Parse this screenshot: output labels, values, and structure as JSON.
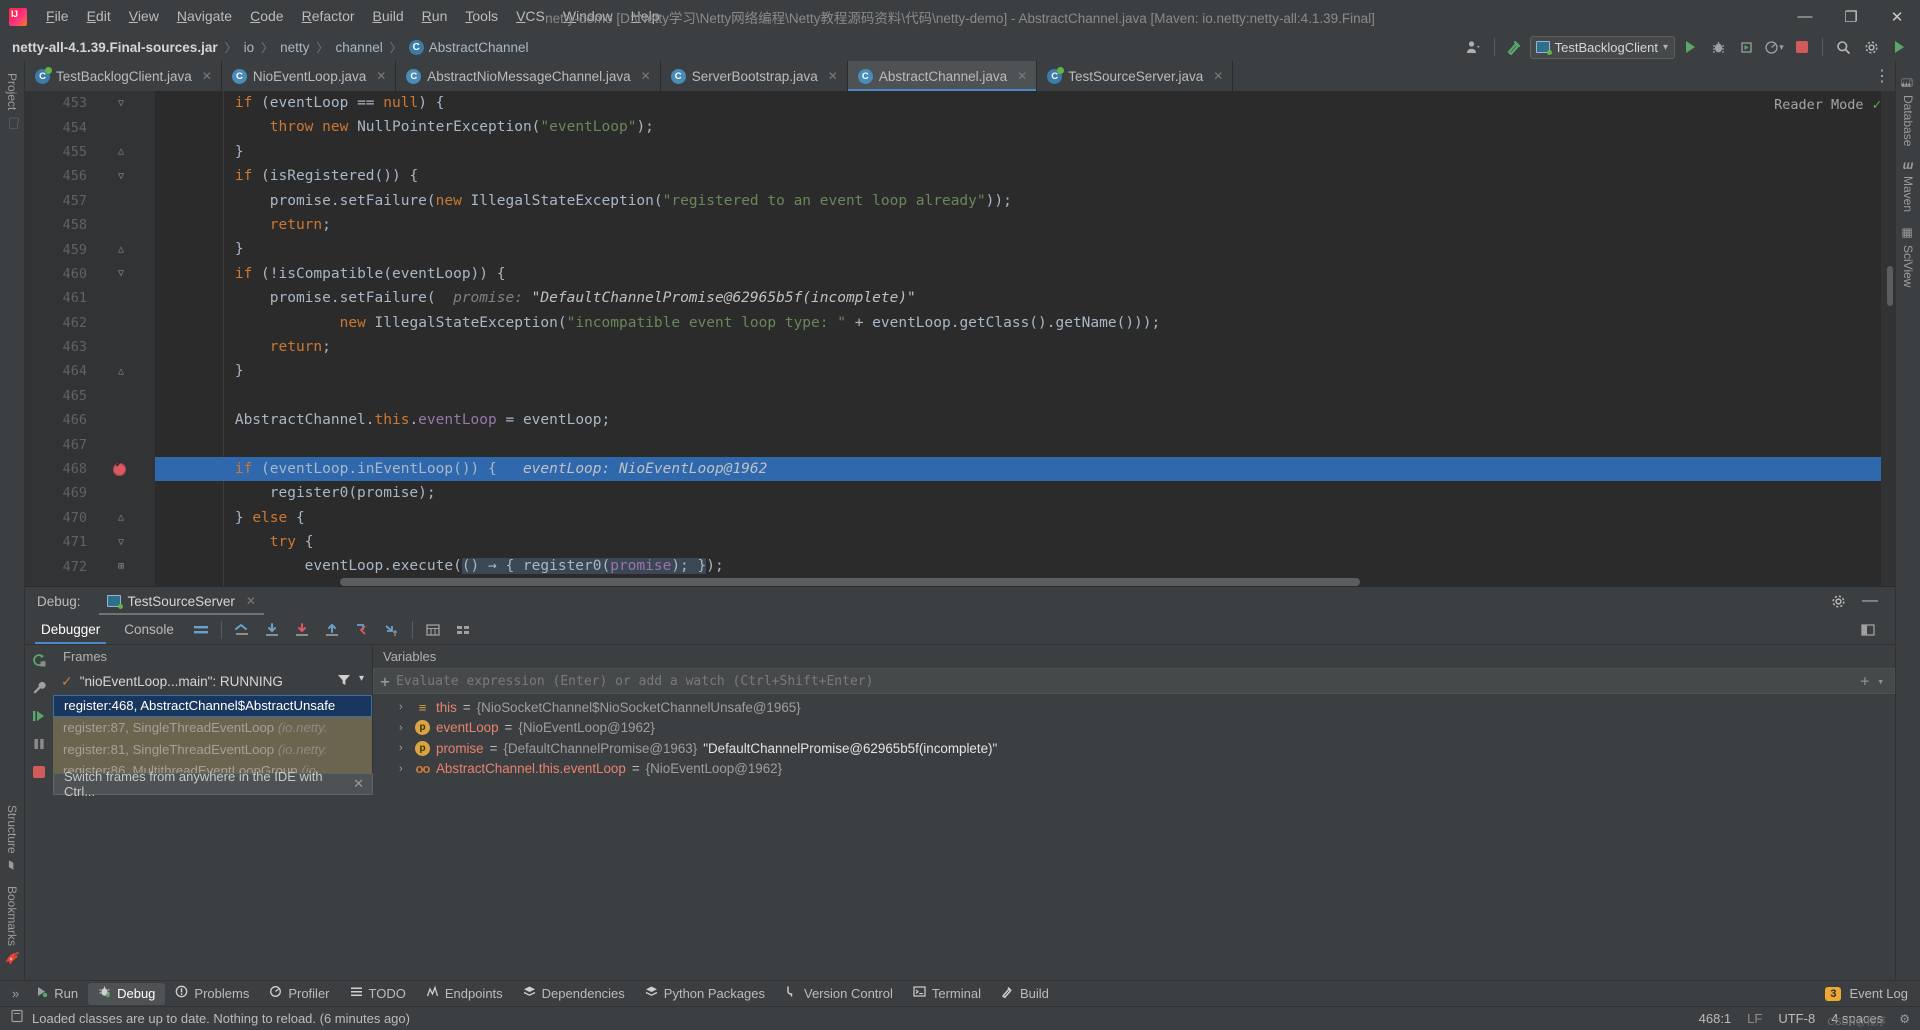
{
  "window": {
    "title": "netty-demo [D:\\Netty学习\\Netty网络编程\\Netty教程源码资料\\代码\\netty-demo] - AbstractChannel.java [Maven: io.netty:netty-all:4.1.39.Final]",
    "minimize": "—",
    "maximize": "❐",
    "close": "✕"
  },
  "menu": [
    {
      "label": "File"
    },
    {
      "label": "Edit"
    },
    {
      "label": "View"
    },
    {
      "label": "Navigate"
    },
    {
      "label": "Code"
    },
    {
      "label": "Refactor"
    },
    {
      "label": "Build"
    },
    {
      "label": "Run"
    },
    {
      "label": "Tools"
    },
    {
      "label": "VCS"
    },
    {
      "label": "Window"
    },
    {
      "label": "Help"
    }
  ],
  "breadcrumb": {
    "jar": "netty-all-4.1.39.Final-sources.jar",
    "seg1": "io",
    "seg2": "netty",
    "seg3": "channel",
    "class_icon": "C",
    "class": "AbstractChannel",
    "separator": "〉"
  },
  "toolbar": {
    "run_config": "TestBacklogClient",
    "dropdown_arrow": "▾",
    "search_icon": "search-icon",
    "settings_icon": "gear-icon",
    "run_icon": "run-icon"
  },
  "tabs": [
    {
      "label": "TestBacklogClient.java",
      "icon": "java-run-class",
      "active": false,
      "close": "✕"
    },
    {
      "label": "NioEventLoop.java",
      "icon": "java-lib-class",
      "active": false,
      "close": "✕"
    },
    {
      "label": "AbstractNioMessageChannel.java",
      "icon": "java-lib-class",
      "active": false,
      "close": "✕"
    },
    {
      "label": "ServerBootstrap.java",
      "icon": "java-lib-class",
      "active": false,
      "close": "✕"
    },
    {
      "label": "AbstractChannel.java",
      "icon": "java-lib-class",
      "active": true,
      "close": "✕"
    },
    {
      "label": "TestSourceServer.java",
      "icon": "java-run-class",
      "active": false,
      "close": "✕"
    }
  ],
  "left_stripe": [
    {
      "label": "Project",
      "icon": "folder-icon"
    },
    {
      "label": "Structure",
      "icon": "structure-icon"
    },
    {
      "label": "Bookmarks",
      "icon": "bookmark-icon"
    }
  ],
  "right_stripe": [
    {
      "label": "Database",
      "icon": "database-icon"
    },
    {
      "label": "Maven",
      "icon": "maven-icon"
    },
    {
      "label": "SciView",
      "icon": "sciview-icon"
    }
  ],
  "editor": {
    "reader_mode": "Reader Mode",
    "reader_check": "✓",
    "first_line": 453,
    "selected_line": 468,
    "lines": [
      {
        "n": 453,
        "fold": "▽",
        "html": "        <span class='kw'>if</span> (eventLoop == <span class='kw'>null</span>) {"
      },
      {
        "n": 454,
        "fold": "",
        "html": "            <span class='kw'>throw new</span> NullPointerException(<span class='str'>\"eventLoop\"</span>);"
      },
      {
        "n": 455,
        "fold": "△",
        "html": "        }"
      },
      {
        "n": 456,
        "fold": "▽",
        "html": "        <span class='kw'>if</span> (isRegistered()) {"
      },
      {
        "n": 457,
        "fold": "",
        "html": "            promise.setFailure(<span class='kw'>new</span> IllegalStateException(<span class='str'>\"registered to an event loop already\"</span>));"
      },
      {
        "n": 458,
        "fold": "",
        "html": "            <span class='kw'>return</span>;"
      },
      {
        "n": 459,
        "fold": "△",
        "html": "        }"
      },
      {
        "n": 460,
        "fold": "▽",
        "html": "        <span class='kw'>if</span> (!isCompatible(eventLoop)) {"
      },
      {
        "n": 461,
        "fold": "",
        "html": "            promise.setFailure(  <span class='hint'>promise: </span><span class='hint2'>\"DefaultChannelPromise@62965b5f(incomplete)\"</span>"
      },
      {
        "n": 462,
        "fold": "",
        "html": "                    <span class='kw'>new</span> IllegalStateException(<span class='str'>\"incompatible event loop type: \"</span> + eventLoop.getClass().getName()));"
      },
      {
        "n": 463,
        "fold": "",
        "html": "            <span class='kw'>return</span>;"
      },
      {
        "n": 464,
        "fold": "△",
        "html": "        }"
      },
      {
        "n": 465,
        "fold": "",
        "html": ""
      },
      {
        "n": 466,
        "fold": "",
        "html": "        AbstractChannel.<span class='kw'>this</span>.<span class='fld'>eventLoop</span> = eventLoop;"
      },
      {
        "n": 467,
        "fold": "",
        "html": ""
      },
      {
        "n": 468,
        "fold": "▽",
        "html": "        <span class='kw'>if</span> (eventLoop.inEventLoop()) {   <span class='hint2'>eventLoop: NioEventLoop@1962</span>",
        "breakpoint": true,
        "selected": true
      },
      {
        "n": 469,
        "fold": "",
        "html": "            register0(promise);"
      },
      {
        "n": 470,
        "fold": "△",
        "html": "        } <span class='kw'>else</span> {"
      },
      {
        "n": 471,
        "fold": "▽",
        "html": "            <span class='kw'>try</span> {"
      },
      {
        "n": 472,
        "fold": "⊞",
        "html": "                eventLoop.execute(<span class='lambda'>() → { register0(<span class='fld'>promise</span>); }</span>);"
      }
    ]
  },
  "debug": {
    "label": "Debug:",
    "session_tab": "TestSourceServer",
    "session_close": "✕",
    "settings_icon": "gear-icon",
    "hide_icon": "minimize-icon",
    "subtabs": [
      {
        "label": "Debugger",
        "active": true
      },
      {
        "label": "Console",
        "active": false
      }
    ],
    "toolbar_icons": [
      "layout-icon",
      "show-execution-point-icon",
      "step-over-icon",
      "step-into-icon",
      "force-step-into-icon",
      "step-out-icon",
      "drop-frame-icon",
      "run-to-cursor-icon",
      "evaluate-expression-icon",
      "mute-breakpoints-icon"
    ],
    "left_icons": [
      "rerun-icon",
      "wrench-icon",
      "resume-icon",
      "pause-icon",
      "stop-icon"
    ],
    "frames": {
      "title": "Frames",
      "thread": "\"nioEventLoop...main\": RUNNING",
      "thread_check": "✓",
      "filter_icon": "filter-icon",
      "dropdown_icon": "▾",
      "items": [
        {
          "text": "register:468, AbstractChannel$AbstractUnsafe",
          "pkg": "",
          "active": true
        },
        {
          "text": "register:87, SingleThreadEventLoop",
          "pkg": "(io.netty.",
          "active": false
        },
        {
          "text": "register:81, SingleThreadEventLoop",
          "pkg": "(io.netty.",
          "active": false
        },
        {
          "text": "register:86, MultithreadEventLoopGroup",
          "pkg": "(io.",
          "active": false
        }
      ],
      "tooltip": "Switch frames from anywhere in the IDE with Ctrl...",
      "tooltip_close": "✕"
    },
    "variables": {
      "title": "Variables",
      "watch_placeholder": "Evaluate expression (Enter) or add a watch (Ctrl+Shift+Enter)",
      "add_icon": "+",
      "items": [
        {
          "arrow": "›",
          "icon": "field-icon",
          "name": "this",
          "eq": " = ",
          "value": "{NioSocketChannel$NioSocketChannelUnsafe@1965}",
          "extra": ""
        },
        {
          "arrow": "›",
          "icon": "param-icon",
          "name": "eventLoop",
          "eq": " = ",
          "value": "{NioEventLoop@1962}",
          "extra": ""
        },
        {
          "arrow": "›",
          "icon": "param-icon",
          "name": "promise",
          "eq": " = ",
          "value": "{DefaultChannelPromise@1963}",
          "extra": "\"DefaultChannelPromise@62965b5f(incomplete)\""
        },
        {
          "arrow": "›",
          "icon": "static-icon",
          "name": "AbstractChannel.this.eventLoop",
          "eq": " = ",
          "value": "{NioEventLoop@1962}",
          "extra": ""
        }
      ]
    }
  },
  "toolwindows": {
    "left_chevron": "»",
    "items": [
      {
        "label": "Run",
        "icon": "run-icon",
        "active": false
      },
      {
        "label": "Debug",
        "icon": "debug-icon",
        "active": true
      },
      {
        "label": "Problems",
        "icon": "problems-icon",
        "active": false
      },
      {
        "label": "Profiler",
        "icon": "profiler-icon",
        "active": false
      },
      {
        "label": "TODO",
        "icon": "todo-icon",
        "active": false
      },
      {
        "label": "Endpoints",
        "icon": "endpoints-icon",
        "active": false
      },
      {
        "label": "Dependencies",
        "icon": "dependencies-icon",
        "active": false
      },
      {
        "label": "Python Packages",
        "icon": "python-icon",
        "active": false
      },
      {
        "label": "Version Control",
        "icon": "vcs-icon",
        "active": false
      },
      {
        "label": "Terminal",
        "icon": "terminal-icon",
        "active": false
      },
      {
        "label": "Build",
        "icon": "build-icon",
        "active": false
      }
    ],
    "event_log": "Event Log",
    "event_log_badge": "3"
  },
  "status": {
    "icon": "reload-icon",
    "message": "Loaded classes are up to date. Nothing to reload. (6 minutes ago)",
    "caret": "468:1",
    "line_sep": "LF",
    "encoding": "UTF-8",
    "indent": "4 spaces",
    "watermark": "CSDN@程序"
  },
  "colors": {
    "accent": "#4a88c7",
    "selection": "#2f68ad",
    "keyword": "#cc7832",
    "string": "#6a8759",
    "field": "#9876aa",
    "breakpoint": "#db5860",
    "frame_active": "#19375e",
    "frame_bg": "#6b6550",
    "badge": "#f0a732"
  }
}
